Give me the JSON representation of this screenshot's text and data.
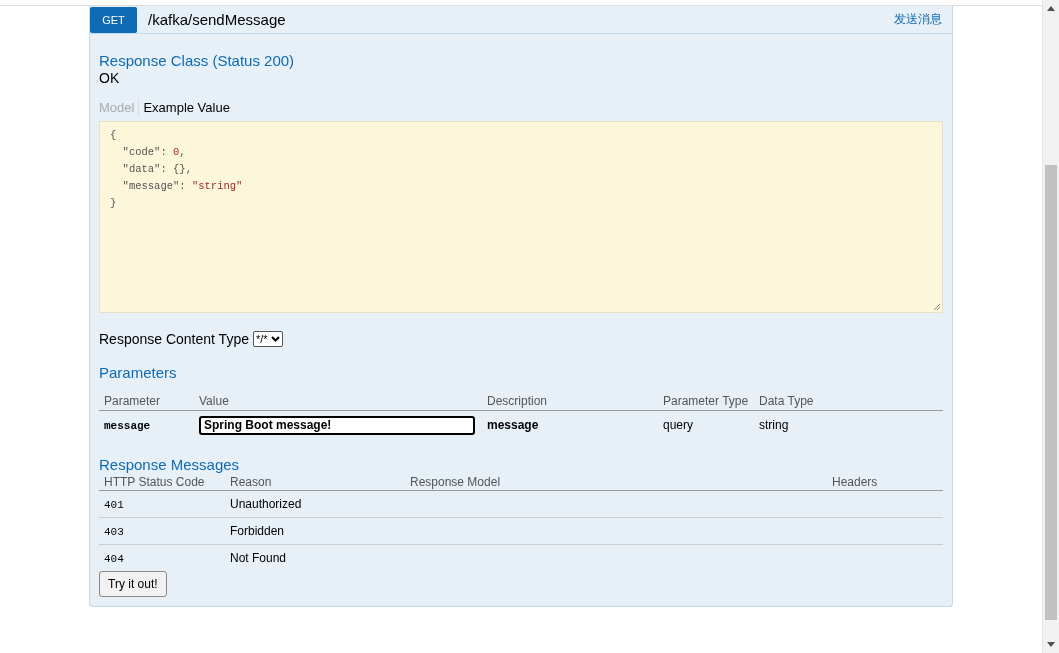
{
  "operation": {
    "method": "GET",
    "path": "/kafka/sendMessage",
    "summary": "发送消息"
  },
  "response_class": {
    "title": "Response Class (Status 200)",
    "text": "OK"
  },
  "model_tabs": [
    {
      "label": "Model",
      "selected": false
    },
    {
      "label": "Example Value",
      "selected": true
    }
  ],
  "example_value": [
    [
      {
        "text": "{",
        "kind": "punct"
      }
    ],
    [
      {
        "text": "  \"code\"",
        "kind": "key"
      },
      {
        "text": ": ",
        "kind": "punct"
      },
      {
        "text": "0",
        "kind": "number"
      },
      {
        "text": ",",
        "kind": "punct"
      }
    ],
    [
      {
        "text": "  \"data\"",
        "kind": "key"
      },
      {
        "text": ": {},",
        "kind": "punct"
      }
    ],
    [
      {
        "text": "  \"message\"",
        "kind": "key"
      },
      {
        "text": ": ",
        "kind": "punct"
      },
      {
        "text": "\"string\"",
        "kind": "string"
      }
    ],
    [
      {
        "text": "}",
        "kind": "punct"
      }
    ]
  ],
  "response_content_type": {
    "label": "Response Content Type",
    "value": "*/*"
  },
  "parameters": {
    "title": "Parameters",
    "columns": [
      "Parameter",
      "Value",
      "Description",
      "Parameter Type",
      "Data Type"
    ],
    "rows": [
      {
        "parameter": "message",
        "value": "Spring Boot message!",
        "description": "message",
        "parameter_type": "query",
        "data_type": "string"
      }
    ]
  },
  "response_messages": {
    "title": "Response Messages",
    "columns": [
      "HTTP Status Code",
      "Reason",
      "Response Model",
      "Headers"
    ],
    "rows": [
      {
        "code": "401",
        "reason": "Unauthorized"
      },
      {
        "code": "403",
        "reason": "Forbidden"
      },
      {
        "code": "404",
        "reason": "Not Found"
      }
    ]
  },
  "buttons": [
    {
      "label": "Try it out!"
    }
  ]
}
